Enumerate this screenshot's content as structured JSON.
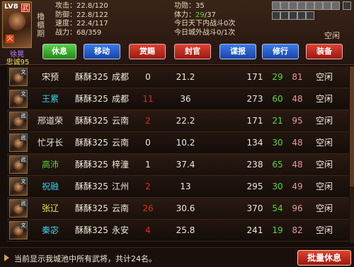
{
  "hero": {
    "level": "LV8",
    "badge": "武",
    "fire": "火",
    "name": "徐晃",
    "loyalty": "忠诚95",
    "tags": [
      "櫓",
      "櫃",
      "期"
    ],
    "stats_left": [
      {
        "label": "攻击",
        "value": "22.8/120"
      },
      {
        "label": "防御",
        "value": "22.8/122"
      },
      {
        "label": "速度",
        "value": "22.4/117"
      },
      {
        "label": "战力",
        "value": "68/359"
      }
    ],
    "merit": {
      "label": "功勋",
      "value": "35"
    },
    "stamina": {
      "label": "体力",
      "current": "29",
      "max": "/37"
    },
    "battle_today_in": "今日天下内战斗0次",
    "battle_today_out": "今日城外战斗0/1次",
    "status": "空闲"
  },
  "actions": [
    {
      "label": "休息",
      "color": "#3aa82a"
    },
    {
      "label": "移动",
      "color": "#2a5ad0"
    },
    {
      "label": "赏赐",
      "color": "#c02a1a"
    },
    {
      "label": "封官",
      "color": "#c02a1a"
    },
    {
      "label": "谍报",
      "color": "#2a5ad0"
    },
    {
      "label": "修行",
      "color": "#2a5ad0"
    },
    {
      "label": "装备",
      "color": "#c02a1a"
    }
  ],
  "generals": [
    {
      "type": "文",
      "name": "宋预",
      "name_color": "white",
      "owner": "酥酥325",
      "city": "成都",
      "n1": "0",
      "n1_color": "white",
      "n2": "21.2",
      "n3": "171",
      "n4": "29",
      "n5": "81",
      "state": "空闲"
    },
    {
      "type": "文",
      "name": "王累",
      "name_color": "cyan",
      "owner": "酥酥325",
      "city": "成都",
      "n1": "11",
      "n1_color": "red",
      "n2": "36",
      "n3": "273",
      "n4": "60",
      "n5": "48",
      "state": "空闲"
    },
    {
      "type": "武",
      "name": "邢道荣",
      "name_color": "white",
      "owner": "酥酥325",
      "city": "云南",
      "n1": "2",
      "n1_color": "red",
      "n2": "22.2",
      "n3": "171",
      "n4": "21",
      "n5": "95",
      "state": "空闲"
    },
    {
      "type": "武",
      "name": "忙牙长",
      "name_color": "white",
      "owner": "酥酥325",
      "city": "云南",
      "n1": "0",
      "n1_color": "white",
      "n2": "10.2",
      "n3": "134",
      "n4": "30",
      "n5": "48",
      "state": "空闲"
    },
    {
      "type": "武",
      "name": "高沛",
      "name_color": "green",
      "owner": "酥酥325",
      "city": "梓潼",
      "n1": "1",
      "n1_color": "white",
      "n2": "37.4",
      "n3": "238",
      "n4": "65",
      "n5": "48",
      "state": "空闲"
    },
    {
      "type": "文",
      "name": "祝融",
      "name_color": "cyan",
      "owner": "酥酥325",
      "city": "江州",
      "n1": "2",
      "n1_color": "red",
      "n2": "13",
      "n3": "295",
      "n4": "30",
      "n5": "49",
      "state": "空闲"
    },
    {
      "type": "武",
      "name": "张辽",
      "name_color": "yellow",
      "owner": "酥酥325",
      "city": "云南",
      "n1": "26",
      "n1_color": "red",
      "n2": "30.6",
      "n3": "370",
      "n4": "54",
      "n5": "96",
      "state": "空闲"
    },
    {
      "type": "文",
      "name": "秦宓",
      "name_color": "cyan",
      "owner": "酥酥325",
      "city": "永安",
      "n1": "4",
      "n1_color": "red",
      "n2": "25.8",
      "n3": "241",
      "n4": "19",
      "n5": "82",
      "state": "空闲"
    }
  ],
  "footer": {
    "text": "当前显示我城池中所有武将，共计24名。",
    "batch_label": "批量休息"
  }
}
